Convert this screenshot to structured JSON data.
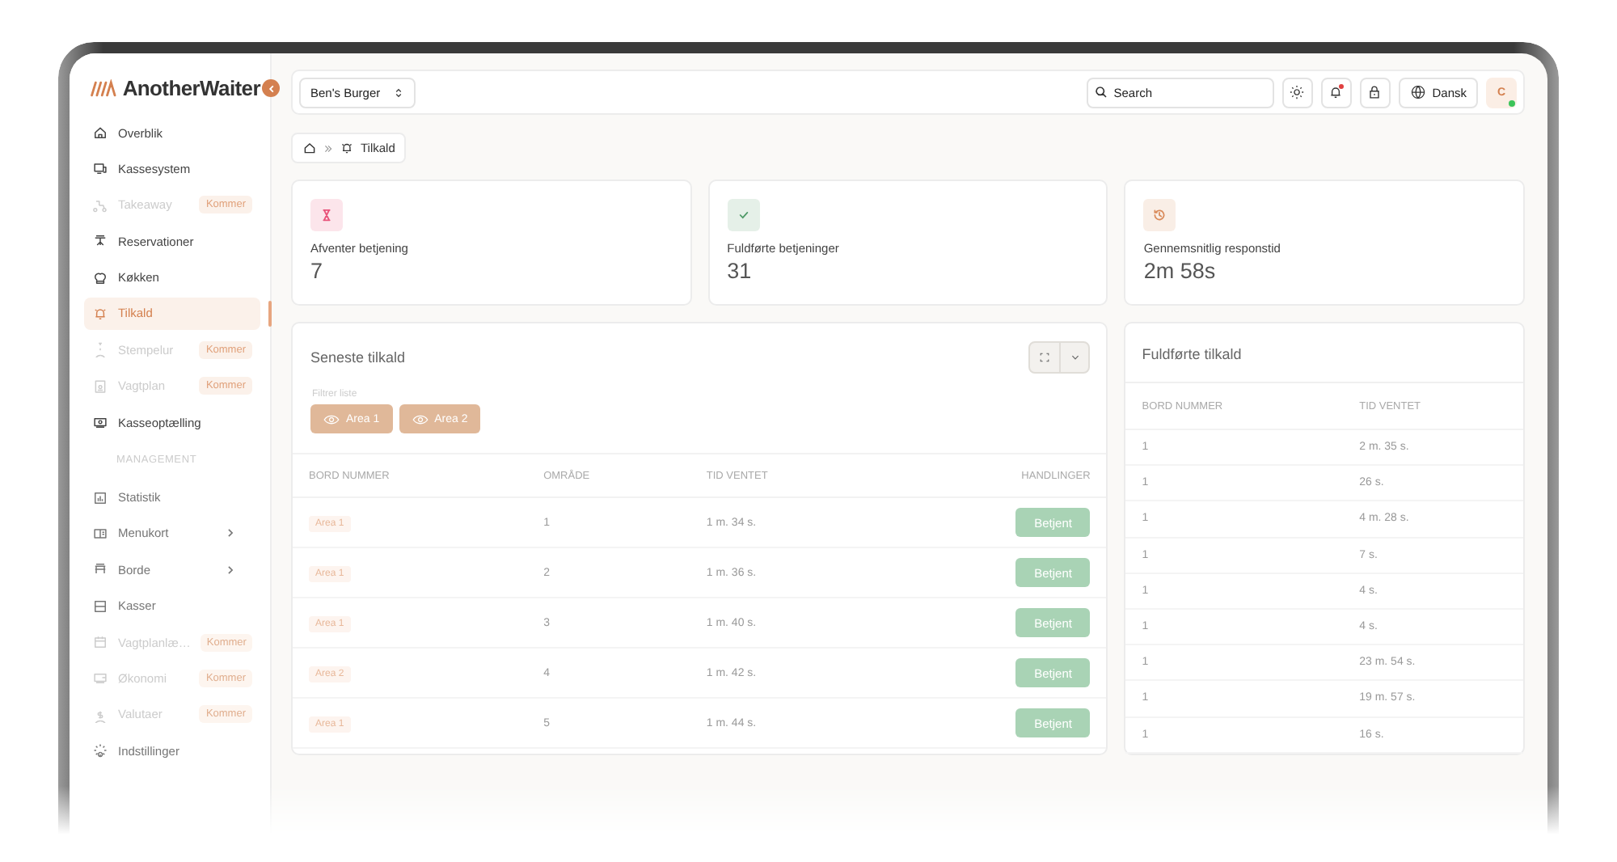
{
  "brand": {
    "name": "AnotherWaiter"
  },
  "sidebar": {
    "items": [
      {
        "label": "Overblik",
        "selected": false,
        "disabled": false
      },
      {
        "label": "Kassesystem",
        "selected": false,
        "disabled": false
      },
      {
        "label": "Takeaway",
        "selected": false,
        "disabled": true,
        "badge": "Kommer"
      },
      {
        "label": "Reservationer",
        "selected": false,
        "disabled": false
      },
      {
        "label": "Køkken",
        "selected": false,
        "disabled": false
      },
      {
        "label": "Tilkald",
        "selected": true,
        "disabled": false
      },
      {
        "label": "Stempelur",
        "selected": false,
        "disabled": true,
        "badge": "Kommer"
      },
      {
        "label": "Vagtplan",
        "selected": false,
        "disabled": true,
        "badge": "Kommer"
      },
      {
        "label": "Kasseoptælling",
        "selected": false,
        "disabled": false
      }
    ],
    "section": "MANAGEMENT",
    "management_items": [
      {
        "label": "Statistik",
        "selected": false,
        "disabled": false,
        "expandable": false
      },
      {
        "label": "Menukort",
        "selected": false,
        "disabled": false,
        "expandable": true
      },
      {
        "label": "Borde",
        "selected": false,
        "disabled": false,
        "expandable": true
      },
      {
        "label": "Kasser",
        "selected": false,
        "disabled": false,
        "expandable": false
      },
      {
        "label": "Vagtplanlæ…",
        "selected": false,
        "disabled": true,
        "expandable": false,
        "badge": "Kommer"
      },
      {
        "label": "Økonomi",
        "selected": false,
        "disabled": true,
        "expandable": false,
        "badge": "Kommer"
      },
      {
        "label": "Valutaer",
        "selected": false,
        "disabled": true,
        "expandable": false,
        "badge": "Kommer"
      },
      {
        "label": "Indstillinger",
        "selected": false,
        "disabled": false,
        "expandable": false
      }
    ]
  },
  "topbar": {
    "restaurant": "Ben's Burger",
    "search": {
      "placeholder": "Search"
    },
    "notifications_unread": true,
    "language": "Dansk",
    "avatar": "C",
    "online": true
  },
  "breadcrumb": {
    "current": "Tilkald"
  },
  "stats": [
    {
      "label": "Afventer betjening",
      "value": "7",
      "color": "#e8537a"
    },
    {
      "label": "Fuldførte betjeninger",
      "value": "31",
      "color": "#4f9a68"
    },
    {
      "label": "Gennemsnitlig responstid",
      "value": "2m 58s",
      "color": "#d98a5a"
    }
  ],
  "recent": {
    "title": "Seneste tilkald",
    "filter_label": "Filtrer liste",
    "filters": [
      {
        "label": "Area 1"
      },
      {
        "label": "Area 2"
      }
    ],
    "columns": [
      "BORD NUMMER",
      "OMRÅDE",
      "TID VENTET",
      "HANDLINGER"
    ],
    "rows": [
      {
        "area": "Area 1",
        "number": "1",
        "waited": "1 m. 34 s.",
        "action": "Betjent"
      },
      {
        "area": "Area 1",
        "number": "2",
        "waited": "1 m. 36 s.",
        "action": "Betjent"
      },
      {
        "area": "Area 1",
        "number": "3",
        "waited": "1 m. 40 s.",
        "action": "Betjent"
      },
      {
        "area": "Area 2",
        "number": "4",
        "waited": "1 m. 42 s.",
        "action": "Betjent"
      },
      {
        "area": "Area 1",
        "number": "5",
        "waited": "1 m. 44 s.",
        "action": "Betjent"
      }
    ]
  },
  "completed": {
    "title": "Fuldførte tilkald",
    "columns": [
      "BORD NUMMER",
      "TID VENTET"
    ],
    "rows": [
      {
        "number": "1",
        "waited": "2 m. 35 s."
      },
      {
        "number": "1",
        "waited": "26 s."
      },
      {
        "number": "1",
        "waited": "4 m. 28 s."
      },
      {
        "number": "1",
        "waited": "7 s."
      },
      {
        "number": "1",
        "waited": "4 s."
      },
      {
        "number": "1",
        "waited": "4 s."
      },
      {
        "number": "1",
        "waited": "23 m. 54 s."
      },
      {
        "number": "1",
        "waited": "19 m. 57 s."
      },
      {
        "number": "1",
        "waited": "16 s."
      }
    ]
  }
}
